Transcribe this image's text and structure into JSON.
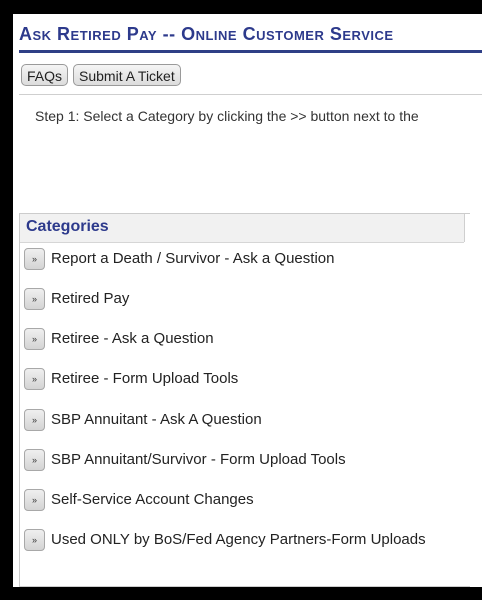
{
  "page": {
    "title": "Ask Retired Pay -- Online Customer Service",
    "instruction": "Step 1: Select a Category by clicking the >> button next to the"
  },
  "toolbar": {
    "faqs_label": "FAQs",
    "submit_ticket_label": "Submit A Ticket"
  },
  "categories": {
    "header": "Categories",
    "button_glyph": "»",
    "items": [
      {
        "label": "Report a Death / Survivor - Ask a Question"
      },
      {
        "label": "Retired Pay"
      },
      {
        "label": "Retiree - Ask a Question"
      },
      {
        "label": "Retiree - Form Upload Tools"
      },
      {
        "label": "SBP Annuitant - Ask A Question"
      },
      {
        "label": "SBP Annuitant/Survivor - Form Upload Tools"
      },
      {
        "label": "Self-Service Account Changes"
      },
      {
        "label": "Used ONLY by BoS/Fed Agency Partners-Form Uploads"
      }
    ]
  },
  "colors": {
    "title": "#2d3a8c",
    "rule": "#2f3f86"
  }
}
